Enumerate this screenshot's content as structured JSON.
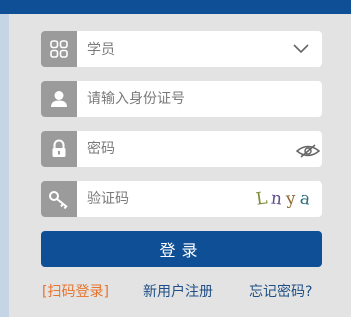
{
  "form": {
    "role_select": {
      "value": "学员",
      "icon": "grid-icon"
    },
    "id_field": {
      "placeholder": "请输入身份证号",
      "icon": "user-icon"
    },
    "password_field": {
      "placeholder": "密码",
      "icon": "lock-icon"
    },
    "captcha_field": {
      "placeholder": "验证码",
      "icon": "key-icon",
      "captcha_chars": [
        "L",
        "n",
        "y",
        "a"
      ]
    },
    "login_label": "登录"
  },
  "links": {
    "scan_login": "[扫码登录]",
    "register": "新用户注册",
    "forgot_password": "忘记密码?"
  },
  "colors": {
    "brand_blue": "#0f4f96",
    "link_orange": "#e8732c",
    "icon_gray": "#9b9b9b",
    "panel_gray": "#e3e3e3"
  }
}
